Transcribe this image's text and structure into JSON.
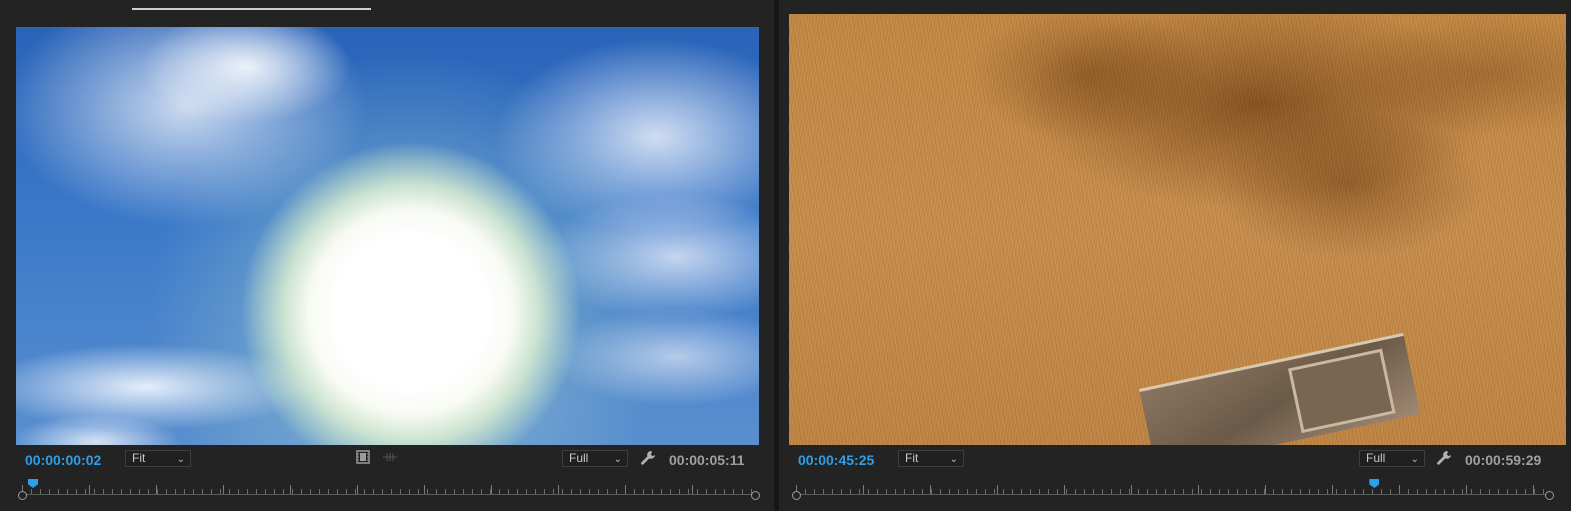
{
  "source_monitor": {
    "timecode": "00:00:00:02",
    "zoom": "Fit",
    "resolution": "Full",
    "duration": "00:00:05:11",
    "playhead_fraction": 0.015,
    "icons": [
      "film-strip-icon",
      "insert-markers-icon",
      "wrench-icon"
    ]
  },
  "program_monitor": {
    "timecode": "00:00:45:25",
    "zoom": "Fit",
    "resolution": "Full",
    "duration": "00:00:59:29",
    "playhead_fraction": 0.767,
    "icons": [
      "wrench-icon"
    ]
  },
  "colors": {
    "timecode_blue": "#2d9fe8",
    "panel_bg": "#232323",
    "duration_gray": "#a0a0a0"
  }
}
